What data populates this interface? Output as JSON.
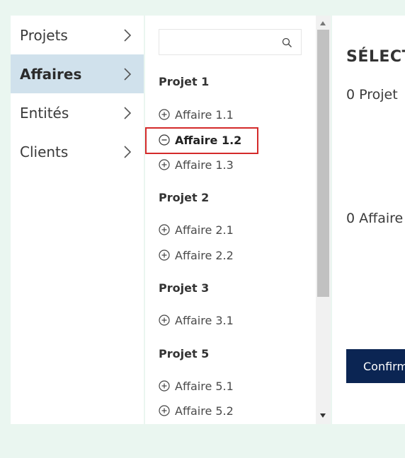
{
  "nav": {
    "items": [
      {
        "label": "Projets"
      },
      {
        "label": "Affaires"
      },
      {
        "label": "Entités"
      },
      {
        "label": "Clients"
      }
    ]
  },
  "search": {
    "value": "",
    "placeholder": ""
  },
  "groups": [
    {
      "title": "Projet 1",
      "items": [
        "Affaire 1.1",
        "Affaire 1.2",
        "Affaire 1.3"
      ]
    },
    {
      "title": "Projet 2",
      "items": [
        "Affaire 2.1",
        "Affaire 2.2"
      ]
    },
    {
      "title": "Projet 3",
      "items": [
        "Affaire 3.1"
      ]
    },
    {
      "title": "Projet 5",
      "items": [
        "Affaire 5.1",
        "Affaire 5.2"
      ]
    }
  ],
  "panel": {
    "title": "SÉLECT",
    "count_projects": "0 Projet",
    "count_affaires": "0 Affaire",
    "confirm_label": "Confirm"
  },
  "colors": {
    "selected_border": "#d42a2a",
    "nav_active": "#d0e1ec",
    "confirm_bg": "#0b2553"
  }
}
